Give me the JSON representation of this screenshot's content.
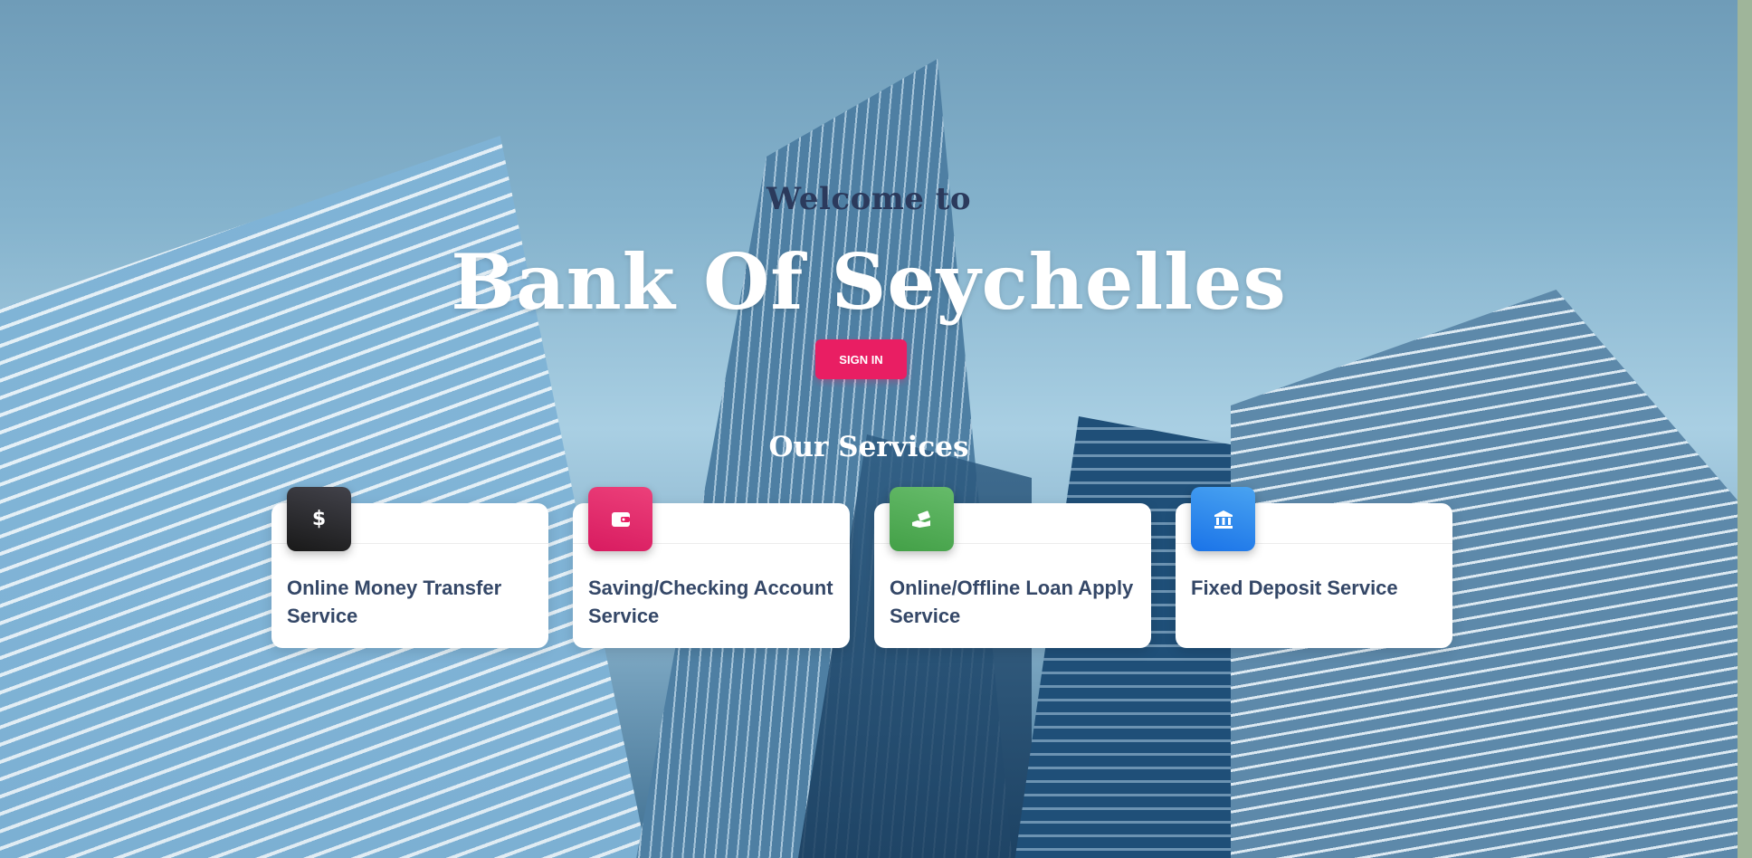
{
  "hero": {
    "welcome": "Welcome to",
    "title": "Bank Of Seychelles",
    "signin_label": "SIGN IN"
  },
  "services": {
    "title": "Our Services",
    "items": [
      {
        "label": "Online Money Transfer Service",
        "icon": "dollar-icon",
        "color": "#2b2b30"
      },
      {
        "label": "Saving/Checking Account Service",
        "icon": "wallet-icon",
        "color": "#e91e63"
      },
      {
        "label": "Online/Offline Loan Apply Service",
        "icon": "hand-money-icon",
        "color": "#4caf50"
      },
      {
        "label": "Fixed Deposit Service",
        "icon": "bank-icon",
        "color": "#1a73e8"
      }
    ]
  },
  "colors": {
    "accent": "#e91e63",
    "heading_dark": "#2b3a5c",
    "card_text": "#344767"
  }
}
